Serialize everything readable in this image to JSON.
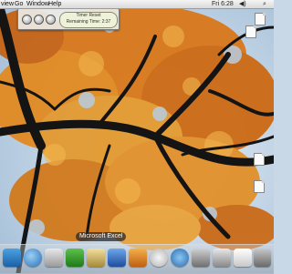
{
  "menubar": {
    "items": [
      "view",
      "Go",
      "Window",
      "Help"
    ],
    "status_text": "Fri 6:28"
  },
  "timer": {
    "line1": "Timer Reset",
    "line2": "Remaining Time: 2:37"
  },
  "desktop_icons": [
    {
      "name": "document-icon",
      "label": ""
    },
    {
      "name": "document-icon",
      "label": ""
    },
    {
      "name": "document-icon",
      "label": ""
    },
    {
      "name": "document-icon",
      "label": ""
    }
  ],
  "dock": {
    "tooltip": "Microsoft Excel",
    "items": [
      "finder-icon",
      "ichat-icon",
      "network-icon",
      "excel-icon",
      "dictionary-icon",
      "word-icon",
      "itunes-icon",
      "photos-icon",
      "safari-icon",
      "quicktime-icon",
      "app-icon",
      "app-icon",
      "cards-icon",
      "calculator-icon",
      "notes-icon",
      "trash-icon"
    ]
  }
}
